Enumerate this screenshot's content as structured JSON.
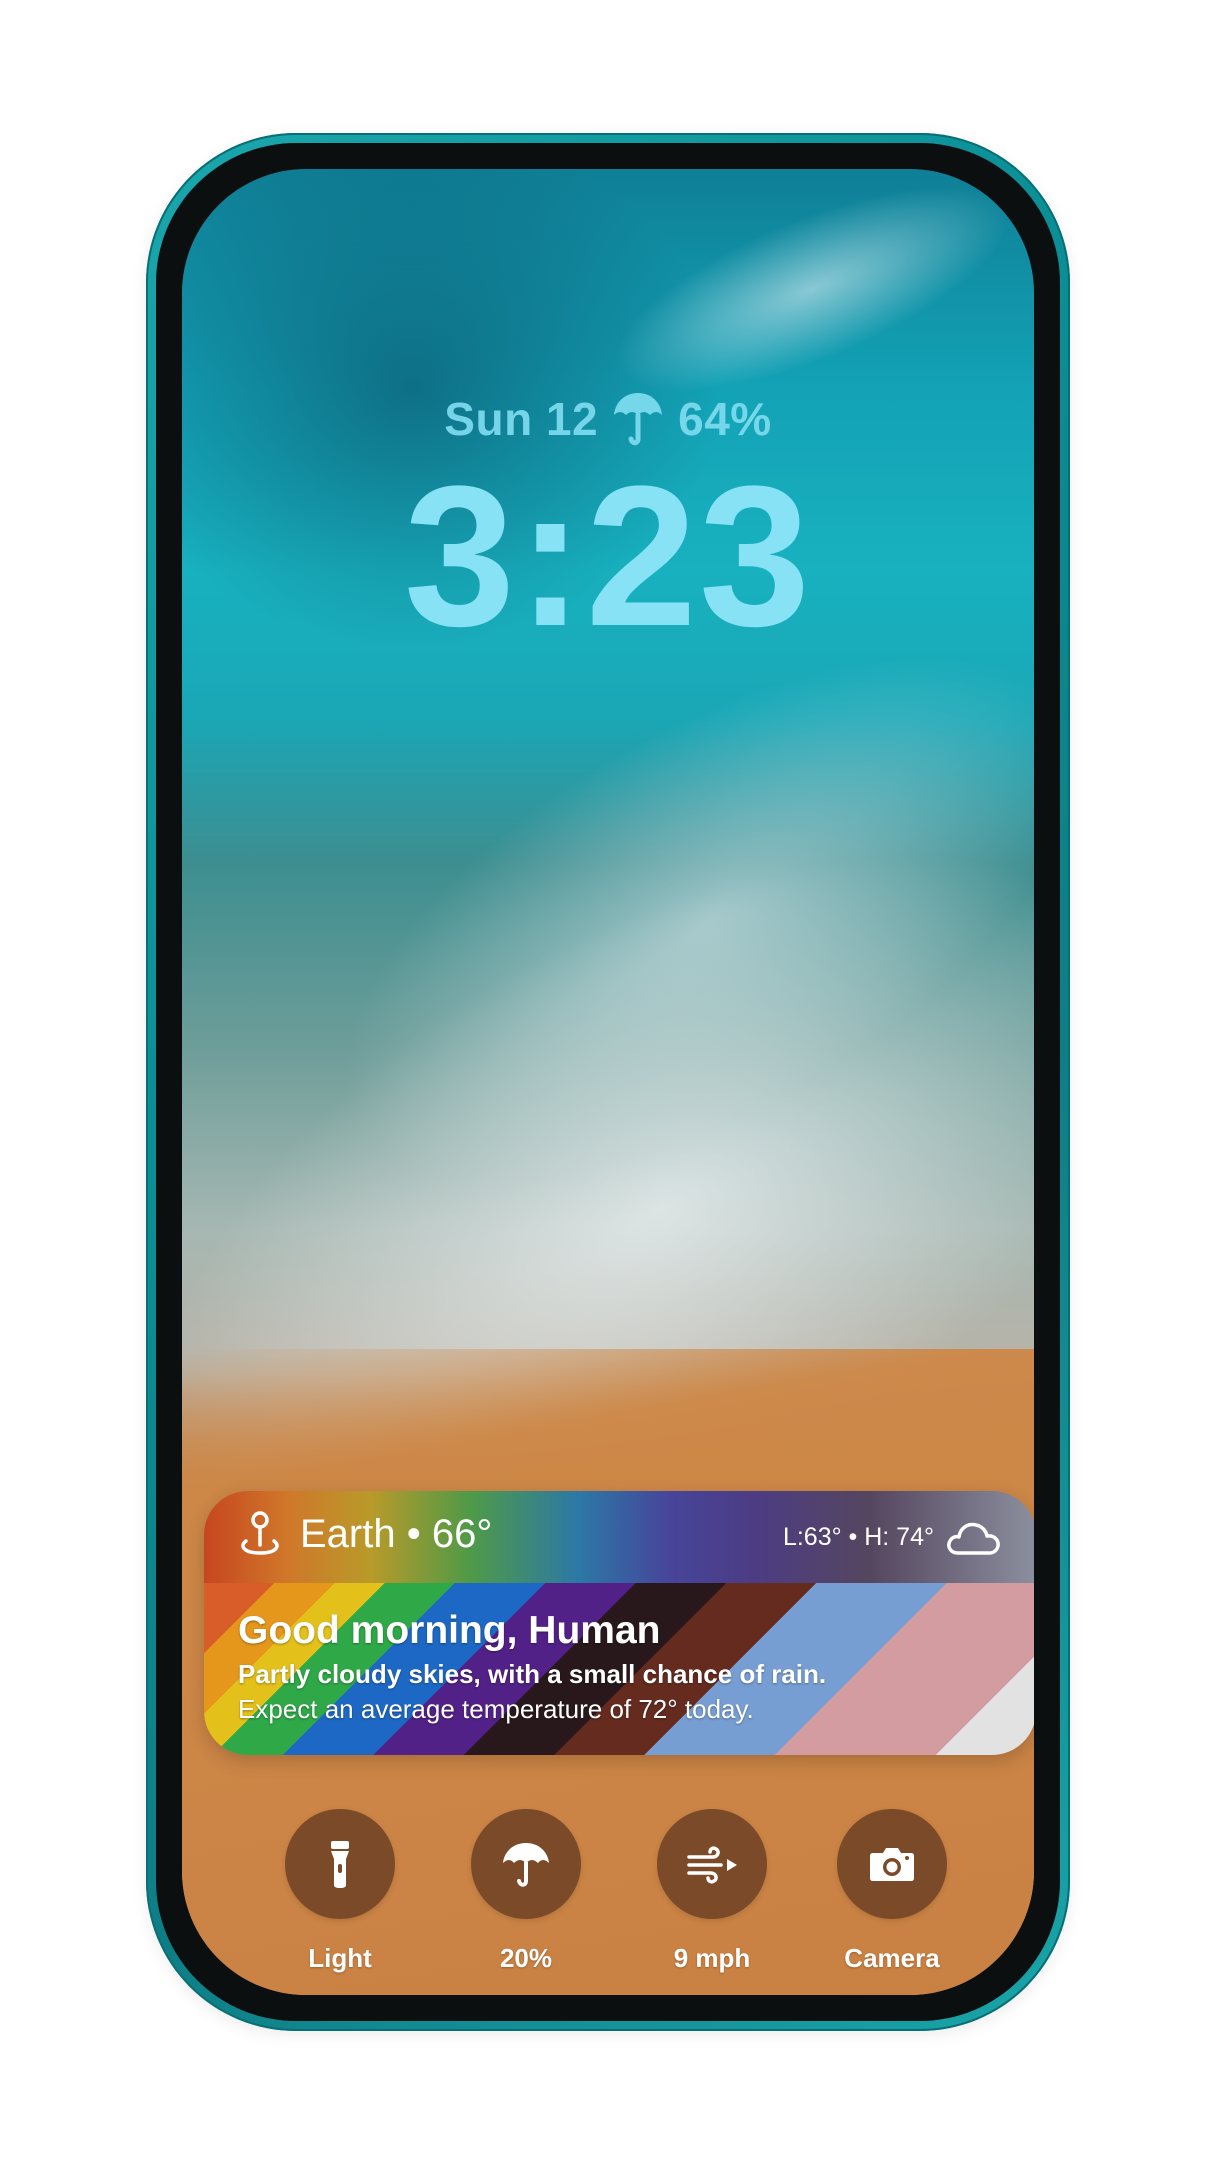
{
  "lock_screen": {
    "date": "Sun 12",
    "date_icon": "umbrella-icon",
    "battery": "64%",
    "time": "3:23"
  },
  "weather_widget": {
    "location_icon": "location-pin-icon",
    "location": "Earth • 66°",
    "low_high": "L:63° • H: 74°",
    "condition_icon": "cloud-icon",
    "greeting": "Good morning, Human",
    "summary": "Partly cloudy skies, with a small chance of rain.",
    "detail": "Expect an average temperature of 72° today."
  },
  "controls": [
    {
      "icon": "flashlight-icon",
      "label": "Light"
    },
    {
      "icon": "umbrella-icon",
      "label": "20%"
    },
    {
      "icon": "wind-icon",
      "label": "9 mph"
    },
    {
      "icon": "camera-icon",
      "label": "Camera"
    }
  ],
  "colors": {
    "phone_frame": "#0b8f96",
    "clock_text": "#86e2f4",
    "control_button": "#7b4a28"
  }
}
